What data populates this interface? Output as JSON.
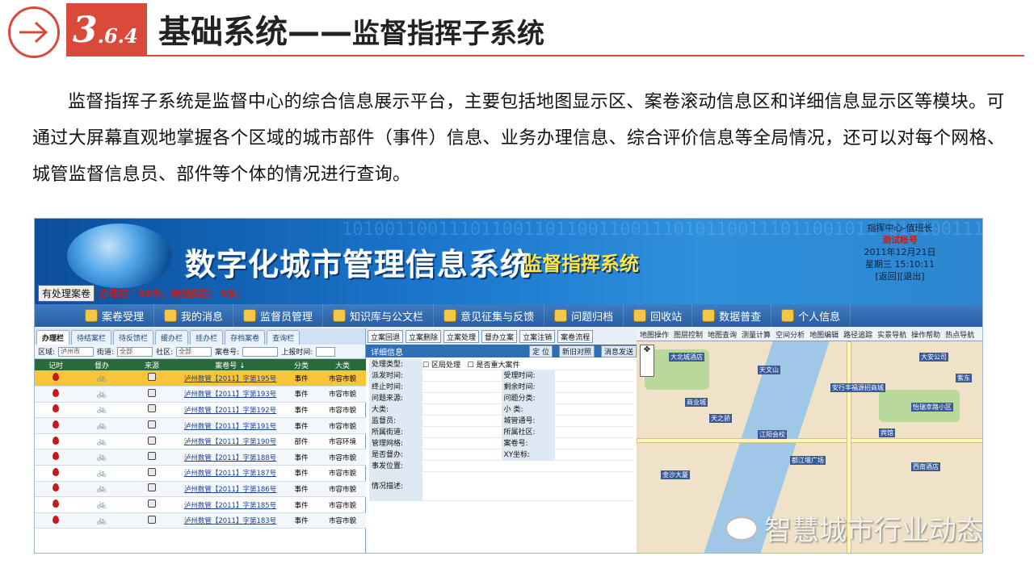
{
  "header": {
    "section_main": "3",
    "section_rest": ".6.4",
    "title_main": "基础系统——",
    "title_sub": "监督指挥子系统"
  },
  "paragraph": "监督指挥子系统是监督中心的综合信息展示平台，主要包括地图显示区、案卷滚动信息区和详细信息显示区等模块。可通过大屏幕直观地掌握各个区域的城市部件（事件）信息、业务办理信息、综合评价信息等全局情况，还可以对每个网格、城管监督信息员、部件等个体的情况进行查询。",
  "screenshot": {
    "binary": "10100110011101100110110011001110101100111011001011 0101001110011101010101001010011101101001101 1001101011010010110101101001010100101011011 01001011010101101001011011010011010110110 1001011101001011010110101101001101011010",
    "system_title": "数字化城市管理信息系统",
    "system_sub": "监督指挥系统",
    "shift": {
      "role": "指挥中心-值班长",
      "account": "测试帐号",
      "date": "2011年12月21日",
      "weekday_time": "星期三 15:10:11",
      "links": "[返回][退出]"
    },
    "pending_button": "有处理案卷",
    "pending_text": "办理栏：58条；待结案栏：3条；",
    "menu": [
      "案卷受理",
      "我的消息",
      "监督员管理",
      "知识库与公文栏",
      "意见征集与反馈",
      "问题归档",
      "回收站",
      "数据普查",
      "个人信息"
    ],
    "tabs": [
      "办理栏",
      "待结案栏",
      "待反馈栏",
      "缓办栏",
      "挂办栏",
      "存档案卷",
      "查询栏"
    ],
    "filters": {
      "district_label": "区域:",
      "district_value": "泸州市",
      "street_label": "街道:",
      "street_value": "全部",
      "community_label": "社区:",
      "community_value": "全部",
      "case_label": "案卷号:",
      "time_label": "上报时间:"
    },
    "columns": [
      "记时",
      "督办",
      "来源",
      "案卷号 ↓",
      "分类",
      "大类"
    ],
    "rows": [
      {
        "case": "泸州数管【2011】字第195号",
        "type": "事件",
        "category": "市容市貌"
      },
      {
        "case": "泸州数管【2011】字第193号",
        "type": "事件",
        "category": "市容市貌"
      },
      {
        "case": "泸州数管【2011】字第192号",
        "type": "事件",
        "category": "市容市貌"
      },
      {
        "case": "泸州数管【2011】字第191号",
        "type": "事件",
        "category": "市容市貌"
      },
      {
        "case": "泸州数管【2011】字第190号",
        "type": "部件",
        "category": "市容环境"
      },
      {
        "case": "泸州数管【2011】字第188号",
        "type": "事件",
        "category": "市容市貌"
      },
      {
        "case": "泸州数管【2011】字第187号",
        "type": "事件",
        "category": "市容市貌"
      },
      {
        "case": "泸州数管【2011】字第186号",
        "type": "事件",
        "category": "市容市貌"
      },
      {
        "case": "泸州数管【2011】字第185号",
        "type": "事件",
        "category": "市容市貌"
      },
      {
        "case": "泸州数管【2011】字第183号",
        "type": "事件",
        "category": "市容市貌"
      }
    ],
    "mid_buttons": [
      "立案回退",
      "立案删除",
      "立案处理",
      "督办立案",
      "立案注销",
      "案卷流程"
    ],
    "detail": {
      "title": "详细信息",
      "buttons": [
        "定 位",
        "新旧对照",
        "消息发送"
      ],
      "type_label": "处理类型:",
      "check1": "区局处理",
      "check2": "是否重大案件",
      "rows": [
        [
          "派发时间:",
          "受理时间:"
        ],
        [
          "终止时间:",
          "剩余时间:"
        ],
        [
          "问题来源:",
          "问题分类:"
        ],
        [
          "大类:",
          "小 类:"
        ],
        [
          "监督员:",
          "城管通号:"
        ],
        [
          "所属街道:",
          "所属社区:"
        ],
        [
          "管理网格:",
          "案卷号:"
        ],
        [
          "是否督办:",
          "XY坐标:"
        ]
      ],
      "location_label": "事发位置:",
      "desc_label": "情况描述:"
    },
    "map_toolbar": [
      "地图操作",
      "图层控制",
      "地图查询",
      "测量计算",
      "空间分析",
      "地图编辑",
      "路径追踪",
      "实景导航",
      "操作帮助",
      "热点导航"
    ],
    "map_pois": [
      "大北城酒店",
      "天文山",
      "商业城",
      "安行丰福源招商城",
      "怡瑞幸路小区",
      "江阳会校",
      "宾馆",
      "天之骄",
      "都江堰广场",
      "西南酒店",
      "大安公司",
      "金沙大厦",
      "紫东"
    ],
    "watermark": "智慧城市行业动态"
  }
}
